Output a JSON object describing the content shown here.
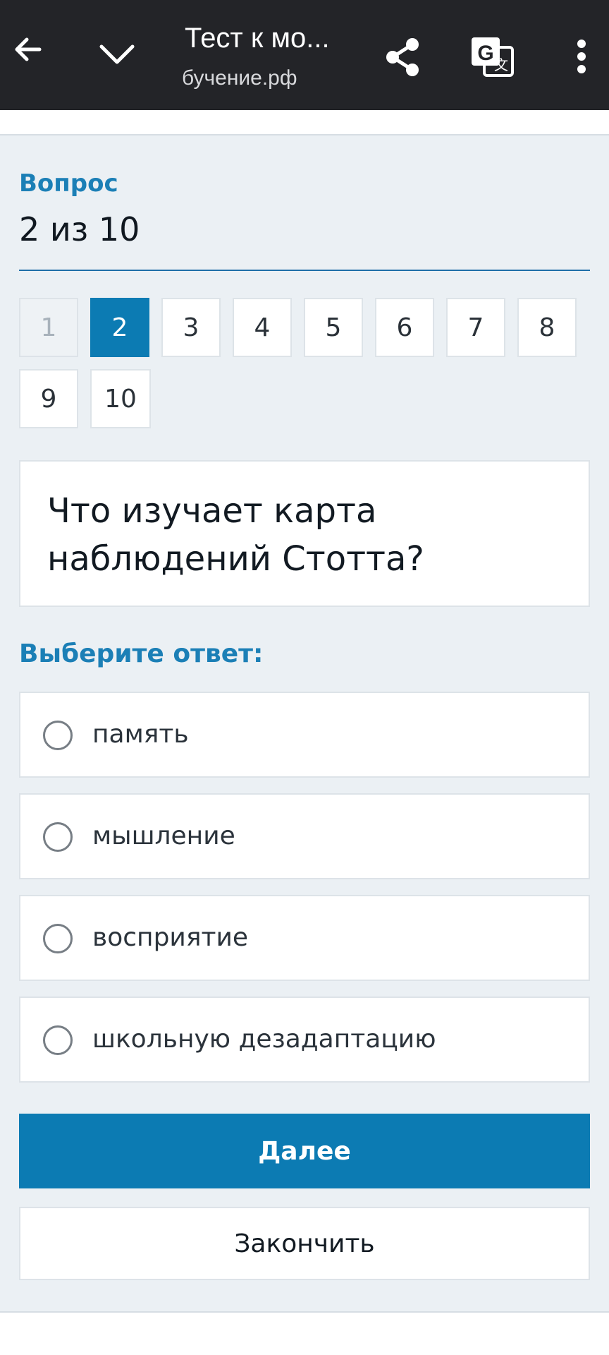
{
  "browser": {
    "title": "Тест к мо...",
    "url": "бучение.рф",
    "icons": [
      "back-arrow-icon",
      "chevron-down-icon",
      "share-icon",
      "translate-icon",
      "more-vertical-icon"
    ]
  },
  "quiz": {
    "question_label": "Вопрос",
    "question_count": "2 из 10",
    "current_question": 2,
    "nav": [
      "1",
      "2",
      "3",
      "4",
      "5",
      "6",
      "7",
      "8",
      "9",
      "10"
    ],
    "question_text": "Что изучает карта наблюдений Стотта?",
    "answer_label": "Выберите ответ:",
    "options": [
      "память",
      "мышление",
      "восприятие",
      "школьную дезадаптацию"
    ],
    "next_label": "Далее",
    "finish_label": "Закончить"
  },
  "colors": {
    "accent": "#0c7bb3",
    "label": "#1b7fb6",
    "topbar": "#232428",
    "background": "#ebf0f4"
  }
}
